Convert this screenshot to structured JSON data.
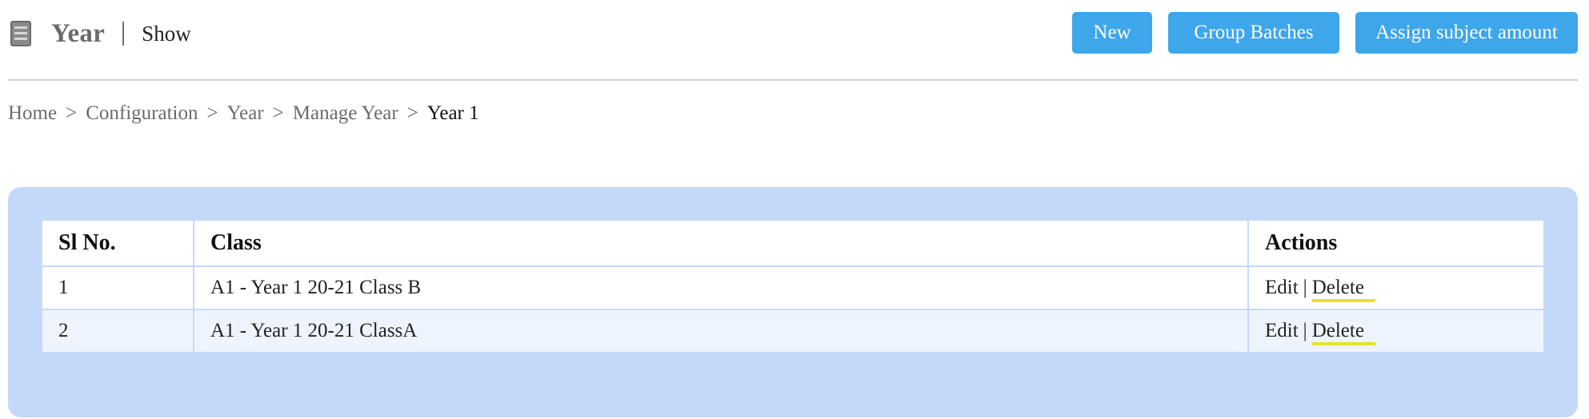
{
  "header": {
    "title": "Year",
    "subtitle": "Show",
    "menu_icon": "menu-icon",
    "buttons": {
      "new": "New",
      "group_batches": "Group Batches",
      "assign_subject_amount": "Assign subject amount"
    },
    "button_color": "#3ea6ea"
  },
  "breadcrumb": {
    "items": [
      "Home",
      "Configuration",
      "Year",
      "Manage Year"
    ],
    "current": "Year 1",
    "separator": ">"
  },
  "table": {
    "columns": [
      "Sl No.",
      "Class",
      "Actions"
    ],
    "rows": [
      {
        "sl": "1",
        "class": "A1 - Year 1 20-21 Class B",
        "edit": "Edit",
        "sep": "|",
        "delete": "Delete"
      },
      {
        "sl": "2",
        "class": "A1 - Year 1 20-21 ClassA",
        "edit": "Edit",
        "sep": "|",
        "delete": "Delete"
      }
    ],
    "panel_color": "#c4d9f9"
  }
}
